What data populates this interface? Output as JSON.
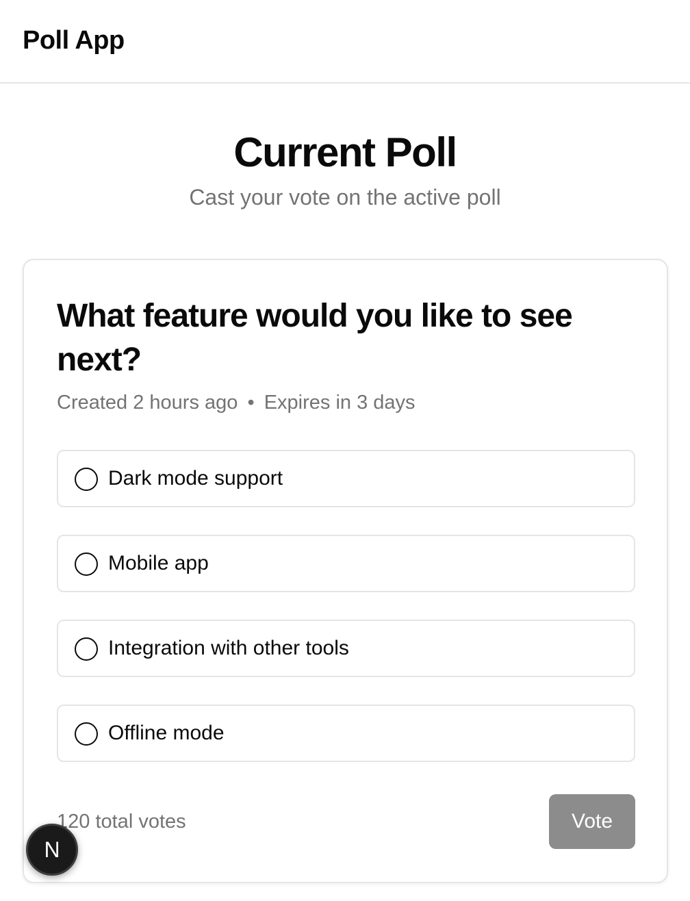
{
  "header": {
    "app_title": "Poll App"
  },
  "page": {
    "title": "Current Poll",
    "subtitle": "Cast your vote on the active poll"
  },
  "poll": {
    "question": "What feature would you like to see next?",
    "created": "Created 2 hours ago",
    "separator": "•",
    "expires": "Expires in 3 days",
    "options": [
      {
        "label": "Dark mode support",
        "selected": false
      },
      {
        "label": "Mobile app",
        "selected": false
      },
      {
        "label": "Integration with other tools",
        "selected": false
      },
      {
        "label": "Offline mode",
        "selected": false
      }
    ],
    "total_votes": "120 total votes",
    "vote_label": "Vote"
  },
  "dev_badge": {
    "letter": "N",
    "icon": "nextjs-icon"
  },
  "colors": {
    "text": "#0a0a0a",
    "muted": "#737373",
    "border": "#e5e5e5",
    "vote_button_disabled": "#8c8c8c",
    "badge_bg": "#1a1a1a"
  }
}
